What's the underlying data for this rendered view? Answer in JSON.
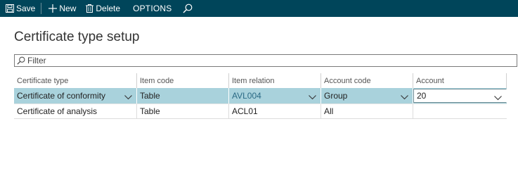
{
  "toolbar": {
    "save_label": "Save",
    "new_label": "New",
    "delete_label": "Delete",
    "options_label": "OPTIONS",
    "bg_color": "#00455a"
  },
  "page": {
    "title": "Certificate type setup"
  },
  "filter": {
    "placeholder": "Filter",
    "value": ""
  },
  "grid": {
    "columns": [
      "Certificate type",
      "Item code",
      "Item relation",
      "Account code",
      "Account"
    ],
    "rows": [
      {
        "certificate_type": "Certificate of conformity",
        "item_code": "Table",
        "item_relation": "AVL004",
        "account_code": "Group",
        "account": "20",
        "selected": true
      },
      {
        "certificate_type": "Certificate of analysis",
        "item_code": "Table",
        "item_relation": "ACL01",
        "account_code": "All",
        "account": "",
        "selected": false
      }
    ],
    "selected_row_color": "#a9d2dc"
  }
}
